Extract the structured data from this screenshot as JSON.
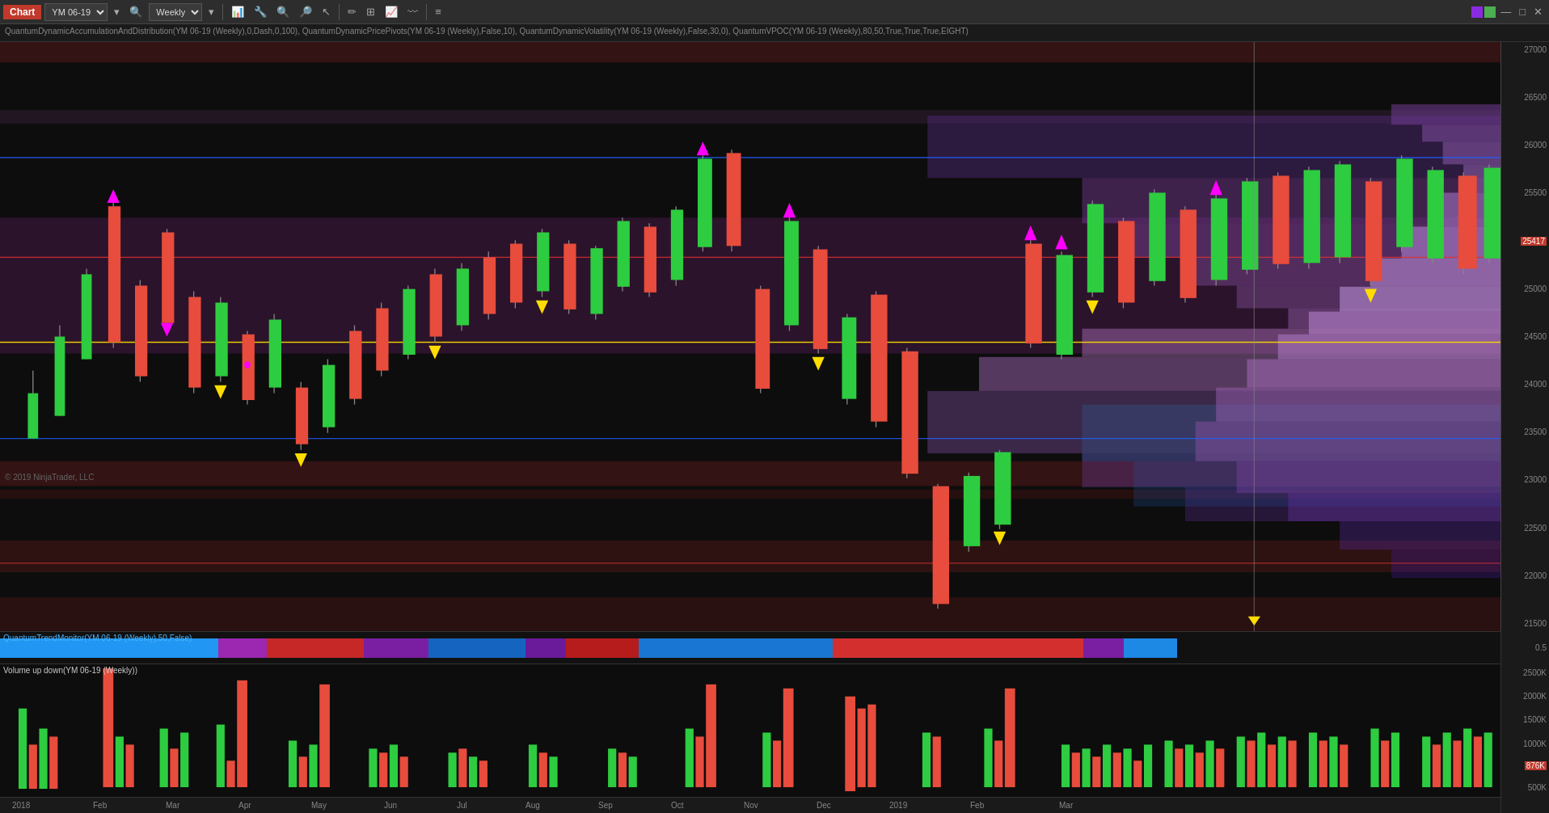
{
  "toolbar": {
    "title": "Chart",
    "symbol": "YM 06-19",
    "timeframe": "Weekly",
    "icons": [
      "bar-chart",
      "wrench",
      "magnify-minus",
      "magnify-plus",
      "arrow",
      "pencil",
      "frame",
      "candle",
      "line",
      "settings"
    ]
  },
  "chart": {
    "title": "QuantumDynamicAccumulationAndDistribution(YM 06-19 (Weekly),0,Dash,0,100), QuantumDynamicPricePivots(YM 06-19 (Weekly),False,10), QuantumDynamicVolatility(YM 06-19 (Weekly),False,30,0), QuantumVPOC(YM 06-19 (Weekly),80,50,True,True,True,EIGHT)",
    "price_levels": [
      "27000",
      "26500",
      "26000",
      "25500",
      "25000",
      "24500",
      "24000",
      "23500",
      "23000",
      "22500",
      "22000",
      "21500"
    ],
    "current_price": "25417",
    "volume_current": "876K",
    "x_labels": [
      "2018",
      "Feb",
      "Mar",
      "Apr",
      "May",
      "Jun",
      "Jul",
      "Aug",
      "Sep",
      "Oct",
      "Nov",
      "Dec",
      "2019",
      "Feb",
      "Mar"
    ],
    "trend_label": "QuantumTrendMonitor(YM 06-19 (Weekly),50,False)",
    "volume_label": "Volume up down(YM 06-19 (Weekly))",
    "volume_ticks": [
      "2500K",
      "2000K",
      "1500K",
      "1000K",
      "500K"
    ],
    "copyright": "© 2019 NinjaTrader, LLC"
  }
}
